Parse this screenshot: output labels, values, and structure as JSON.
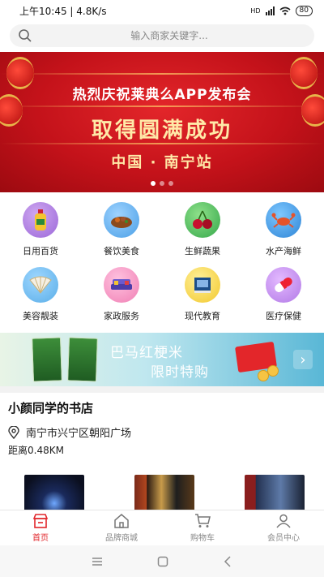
{
  "status_bar": {
    "time_speed": "上午10:45 | 4.8K/s",
    "network": "HD",
    "battery": "80"
  },
  "search": {
    "placeholder": "输入商家关键字..."
  },
  "banner": {
    "line1": "热烈庆祝莱典么APP发布会",
    "line2": "取得圆满成功",
    "line3": "中国 · 南宁站"
  },
  "categories": [
    {
      "label": "日用百货",
      "icon": "oil-bottle-icon"
    },
    {
      "label": "餐饮美食",
      "icon": "food-dish-icon"
    },
    {
      "label": "生鲜蔬果",
      "icon": "cherry-icon"
    },
    {
      "label": "水产海鲜",
      "icon": "crab-icon"
    },
    {
      "label": "美容靓装",
      "icon": "fan-icon"
    },
    {
      "label": "家政服务",
      "icon": "sofa-icon"
    },
    {
      "label": "现代教育",
      "icon": "book-icon"
    },
    {
      "label": "医疗保健",
      "icon": "pill-icon"
    }
  ],
  "promo": {
    "title": "巴马红梗米",
    "subtitle": "限时特购",
    "arrow": "›"
  },
  "store": {
    "name": "小颜同学的书店",
    "address": "南宁市兴宁区朝阳广场",
    "distance": "距离0.48KM",
    "book_covers": [
      "dark-blue-book",
      "book-set-red",
      "dragon-book"
    ]
  },
  "tabbar": {
    "items": [
      {
        "label": "首页",
        "active": true
      },
      {
        "label": "品牌商城",
        "active": false
      },
      {
        "label": "购物车",
        "active": false
      },
      {
        "label": "会员中心",
        "active": false
      }
    ]
  },
  "colors": {
    "accent": "#e1262b",
    "banner_red": "#c4121a",
    "gold": "#ffe9a8"
  }
}
